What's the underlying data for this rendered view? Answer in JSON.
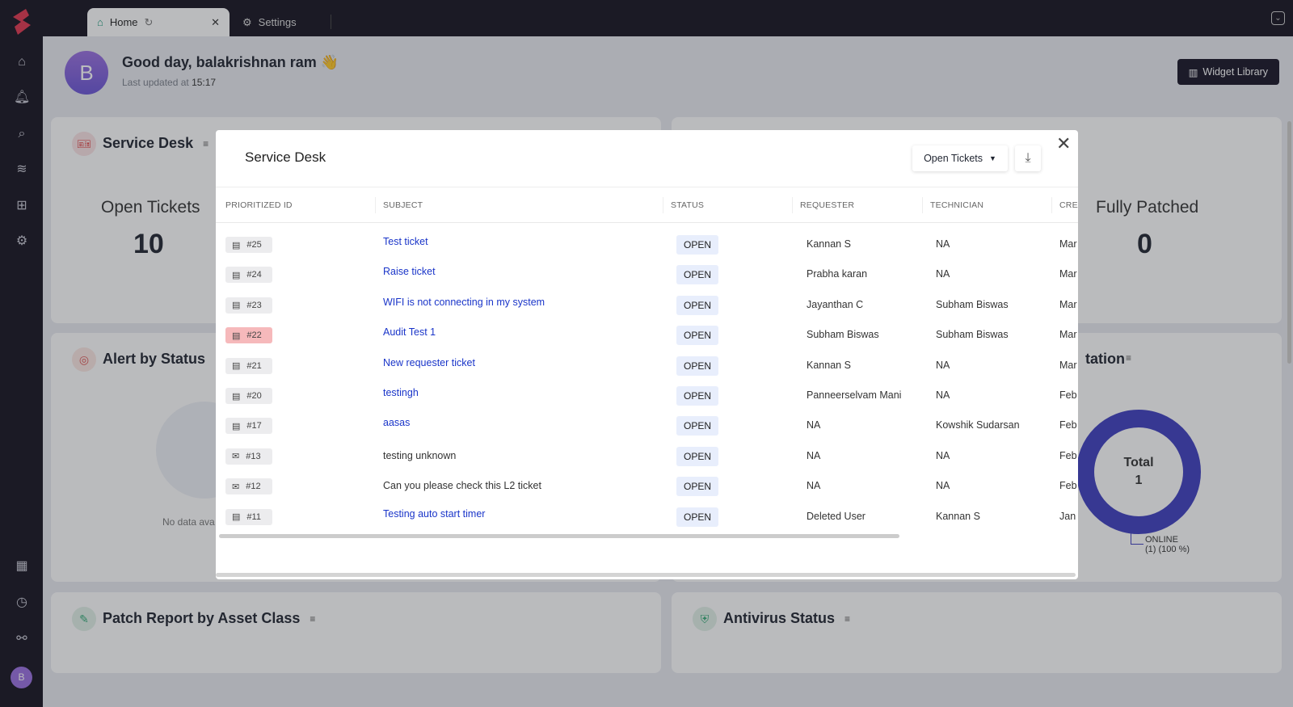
{
  "tabs": [
    {
      "label": "Home",
      "icon": "home-icon"
    },
    {
      "label": "Settings",
      "icon": "gear-icon"
    }
  ],
  "header": {
    "avatar_letter": "B",
    "greeting": "Good day, balakrishnan ram 👋",
    "updated_label": "Last updated at",
    "updated_time": "15:17",
    "widget_library": "Widget Library"
  },
  "cards": {
    "service_desk": {
      "title": "Service Desk",
      "metric_label": "Open Tickets",
      "metric_value": "10"
    },
    "patched": {
      "metric_label": "Fully Patched",
      "metric_value": "0"
    },
    "alert": {
      "title": "Alert by Status",
      "empty": "No data ava"
    },
    "station": {
      "title": "tation",
      "total_label": "Total",
      "total_value": "1",
      "legend": "ONLINE",
      "legend_detail": "(1) (100 %)",
      "color": "#3f3fc0"
    },
    "patch": {
      "title": "Patch Report by Asset Class"
    },
    "antivirus": {
      "title": "Antivirus Status"
    }
  },
  "modal": {
    "title": "Service Desk",
    "filter": "Open Tickets",
    "columns": [
      "PRIORITIZED ID",
      "SUBJECT",
      "STATUS",
      "REQUESTER",
      "TECHNICIAN",
      "CREA"
    ],
    "rows": [
      {
        "id": "#25",
        "subject": "Test ticket",
        "link": true,
        "status": "OPEN",
        "requester": "Kannan S",
        "technician": "NA",
        "created": "Mar"
      },
      {
        "id": "#24",
        "subject": "Raise ticket",
        "link": true,
        "status": "OPEN",
        "requester": "Prabha karan",
        "technician": "NA",
        "created": "Mar"
      },
      {
        "id": "#23",
        "subject": "WIFI is not connecting in my system",
        "link": true,
        "status": "OPEN",
        "requester": "Jayanthan C",
        "technician": "Subham Biswas",
        "created": "Mar"
      },
      {
        "id": "#22",
        "subject": "Audit Test 1",
        "link": true,
        "status": "OPEN",
        "requester": "Subham Biswas",
        "technician": "Subham Biswas",
        "created": "Mar",
        "red": true
      },
      {
        "id": "#21",
        "subject": "New requester ticket",
        "link": true,
        "status": "OPEN",
        "requester": "Kannan S",
        "technician": "NA",
        "created": "Mar"
      },
      {
        "id": "#20",
        "subject": "testingh",
        "link": true,
        "status": "OPEN",
        "requester": "Panneerselvam Mani",
        "technician": "NA",
        "created": "Feb"
      },
      {
        "id": "#17",
        "subject": "aasas",
        "link": true,
        "status": "OPEN",
        "requester": "NA",
        "technician": "Kowshik Sudarsan",
        "created": "Feb"
      },
      {
        "id": "#13",
        "subject": "testing unknown",
        "link": false,
        "status": "OPEN",
        "requester": "NA",
        "technician": "NA",
        "created": "Feb",
        "mail": true
      },
      {
        "id": "#12",
        "subject": "Can you please check this L2 ticket",
        "link": false,
        "status": "OPEN",
        "requester": "NA",
        "technician": "NA",
        "created": "Feb",
        "mail": true
      },
      {
        "id": "#11",
        "subject": "Testing auto start timer",
        "link": true,
        "status": "OPEN",
        "requester": "Deleted User",
        "technician": "Kannan S",
        "created": "Jan"
      }
    ]
  }
}
